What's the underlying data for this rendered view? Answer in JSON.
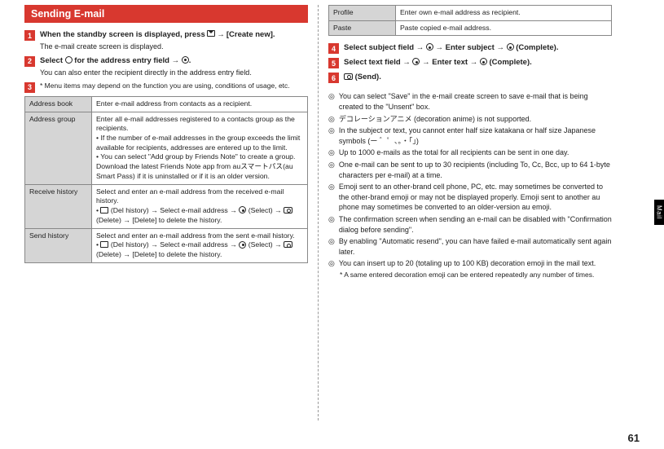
{
  "heading": "Sending E-mail",
  "steps_left": [
    {
      "num": "1",
      "title_pre": "When the standby screen is displayed, press ",
      "title_post": " → [Create new].",
      "sub": "The e-mail create screen is displayed."
    },
    {
      "num": "2",
      "title_pre": "Select ",
      "title_mid": " for the address entry field → ",
      "title_post": ".",
      "sub": "You can also enter the recipient directly in the address entry field."
    },
    {
      "num": "3",
      "note": "* Menu items may depend on the function you are using, conditions of usage, etc."
    }
  ],
  "table_left": [
    {
      "label": "Address book",
      "desc": "Enter e-mail address from contacts as a recipient."
    },
    {
      "label": "Address group",
      "desc": "Enter all e-mail addresses registered to a contacts group as the recipients.\n• If the number of e-mail addresses in the group exceeds the limit available for recipients, addresses are entered up to the limit.\n• You can select \"Add group by Friends Note\" to create a group. Download the latest Friends Note app from auスマートパス(au Smart Pass) if it is uninstalled or if it is an older version."
    },
    {
      "label": "Receive history",
      "desc": "Select and enter an e-mail address from the received e-mail history.\n• [icon] (Del history) → Select e-mail address → [dot] (Select) → [cam] (Delete) → [Delete] to delete the history."
    },
    {
      "label": "Send history",
      "desc": "Select and enter an e-mail address from the sent e-mail history.\n• [icon] (Del history) → Select e-mail address → [dot] (Select) → [cam] (Delete) → [Delete] to delete the history."
    }
  ],
  "table_right": [
    {
      "label": "Profile",
      "desc": "Enter own e-mail address as recipient."
    },
    {
      "label": "Paste",
      "desc": "Paste copied e-mail address."
    }
  ],
  "steps_right": [
    {
      "num": "4",
      "title": "Select subject field → [dot] → Enter subject → [dot] (Complete)."
    },
    {
      "num": "5",
      "title": "Select text field → [dot] → Enter text → [dot] (Complete)."
    },
    {
      "num": "6",
      "title": "[cam] (Send)."
    }
  ],
  "notes": [
    "You can select \"Save\" in the e-mail create screen to save e-mail that is being created to the \"Unsent\" box.",
    "デコレーションアニメ (decoration anime) is not supported.",
    "In the subject or text, you cannot enter half size katakana or half size Japanese symbols (ー ゛゜、。・「」)",
    "Up to 1000 e-mails as the total for all recipients can be sent in one day.",
    "One e-mail can be sent to up to 30 recipients (including To, Cc, Bcc, up to 64 1-byte characters per e-mail) at a time.",
    "Emoji sent to an other-brand cell phone, PC, etc. may sometimes be converted to the other-brand emoji or may not be displayed properly. Emoji sent to another au phone may sometimes be converted to an older-version au emoji.",
    "The confirmation screen when sending an e-mail can be disabled with \"Confirmation dialog before sending\".",
    "By enabling \"Automatic resend\", you can have failed e-mail automatically sent again later.",
    "You can insert up to 20 (totaling up to 100 KB) decoration emoji in the mail text."
  ],
  "sub_note": "* A same entered decoration emoji can be entered repeatedly any number of times.",
  "side_tab": "Mail",
  "page_num": "61"
}
